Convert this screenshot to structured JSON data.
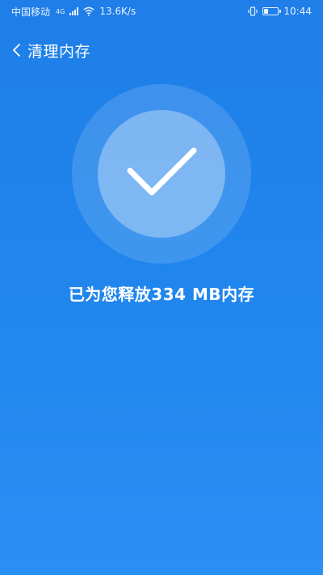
{
  "status_bar": {
    "carrier": "中国移动",
    "network_type": "4G",
    "speed": "13.6K/s",
    "time": "10:44",
    "battery_level": 0.3
  },
  "header": {
    "title": "清理内存",
    "back_icon": "chevron-left-icon"
  },
  "success": {
    "icon": "checkmark-icon"
  },
  "result": {
    "message": "已为您释放334 MB内存"
  },
  "colors": {
    "background_top": "#1f7ee8",
    "background_bottom": "#2a8ff5",
    "text": "#ffffff"
  }
}
